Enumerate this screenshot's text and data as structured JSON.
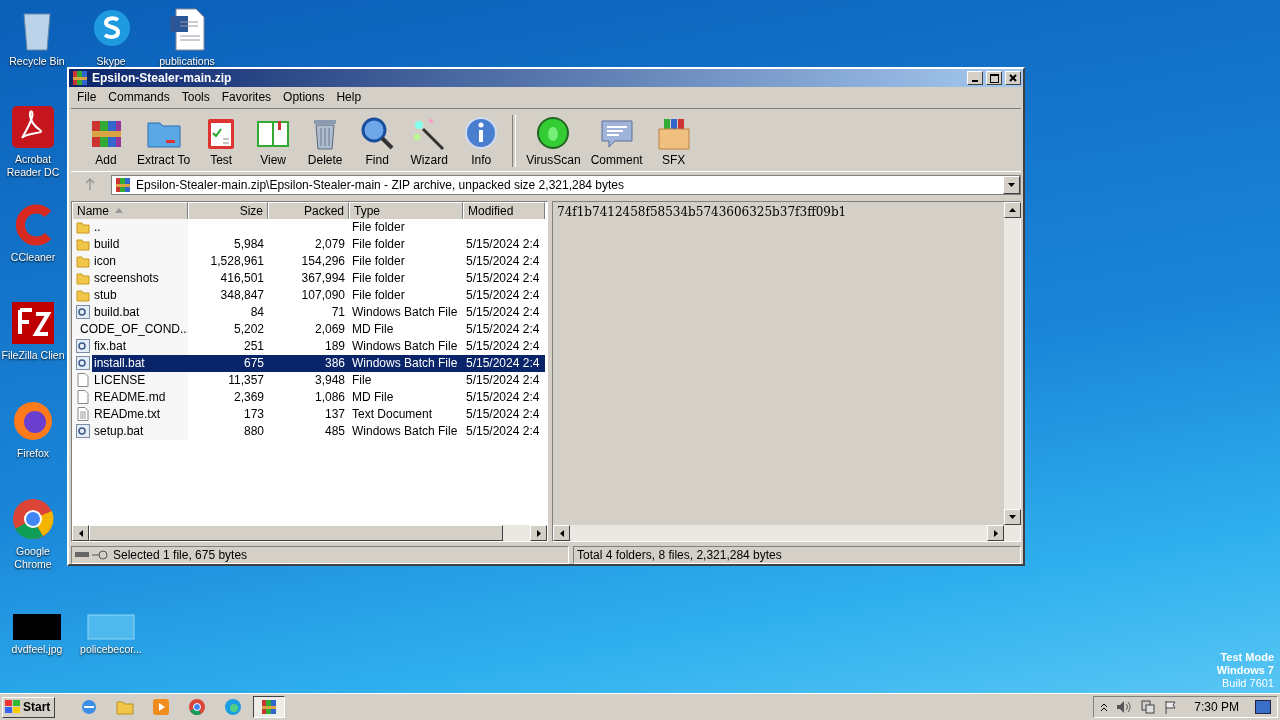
{
  "desktop": {
    "icons": [
      {
        "label": "Recycle Bin",
        "kind": "bin"
      },
      {
        "label": "Skype",
        "kind": "skype"
      },
      {
        "label": "publications",
        "kind": "word"
      },
      {
        "label": "Acrobat Reader DC",
        "kind": "acrobat"
      },
      {
        "label": "CCleaner",
        "kind": "ccleaner"
      },
      {
        "label": "FileZilla Clien",
        "kind": "filezilla"
      },
      {
        "label": "Firefox",
        "kind": "firefox"
      },
      {
        "label": "Google Chrome",
        "kind": "chrome"
      },
      {
        "label": "dvdfeel.jpg",
        "kind": "imageblack"
      },
      {
        "label": "policebecor...",
        "kind": "imageblank"
      }
    ],
    "os_info": [
      "Test Mode",
      "Windows 7",
      "Build 7601"
    ]
  },
  "window": {
    "title": "Epsilon-Stealer-main.zip",
    "menu": [
      "File",
      "Commands",
      "Tools",
      "Favorites",
      "Options",
      "Help"
    ],
    "toolbar": [
      {
        "label": "Add",
        "kind": "add"
      },
      {
        "label": "Extract To",
        "kind": "extract"
      },
      {
        "label": "Test",
        "kind": "test"
      },
      {
        "label": "View",
        "kind": "view"
      },
      {
        "label": "Delete",
        "kind": "delete"
      },
      {
        "label": "Find",
        "kind": "find"
      },
      {
        "label": "Wizard",
        "kind": "wizard"
      },
      {
        "label": "Info",
        "kind": "info"
      },
      {
        "label": "VirusScan",
        "kind": "virus"
      },
      {
        "label": "Comment",
        "kind": "comment"
      },
      {
        "label": "SFX",
        "kind": "sfx"
      }
    ],
    "address": "Epsilon-Stealer-main.zip\\Epsilon-Stealer-main - ZIP archive, unpacked size 2,321,284 bytes",
    "columns": [
      {
        "label": "Name",
        "sorted": true
      },
      {
        "label": "Size",
        "sorted": false
      },
      {
        "label": "Packed",
        "sorted": false
      },
      {
        "label": "Type",
        "sorted": false
      },
      {
        "label": "Modified",
        "sorted": false
      }
    ],
    "files": [
      {
        "name": "..",
        "type": "File folder",
        "kind": "folder",
        "selected": false
      },
      {
        "name": "build",
        "size": "5,984",
        "packed": "2,079",
        "type": "File folder",
        "modified": "5/15/2024 2:4",
        "kind": "folder",
        "selected": false
      },
      {
        "name": "icon",
        "size": "1,528,961",
        "packed": "154,296",
        "type": "File folder",
        "modified": "5/15/2024 2:4",
        "kind": "folder",
        "selected": false
      },
      {
        "name": "screenshots",
        "size": "416,501",
        "packed": "367,994",
        "type": "File folder",
        "modified": "5/15/2024 2:4",
        "kind": "folder",
        "selected": false
      },
      {
        "name": "stub",
        "size": "348,847",
        "packed": "107,090",
        "type": "File folder",
        "modified": "5/15/2024 2:4",
        "kind": "folder",
        "selected": false
      },
      {
        "name": "build.bat",
        "size": "84",
        "packed": "71",
        "type": "Windows Batch File",
        "modified": "5/15/2024 2:4",
        "kind": "batch",
        "selected": false
      },
      {
        "name": "CODE_OF_COND...",
        "size": "5,202",
        "packed": "2,069",
        "type": "MD File",
        "modified": "5/15/2024 2:4",
        "kind": "file",
        "selected": false
      },
      {
        "name": "fix.bat",
        "size": "251",
        "packed": "189",
        "type": "Windows Batch File",
        "modified": "5/15/2024 2:4",
        "kind": "batch",
        "selected": false
      },
      {
        "name": "install.bat",
        "size": "675",
        "packed": "386",
        "type": "Windows Batch File",
        "modified": "5/15/2024 2:4",
        "kind": "batch",
        "selected": true
      },
      {
        "name": "LICENSE",
        "size": "11,357",
        "packed": "3,948",
        "type": "File",
        "modified": "5/15/2024 2:4",
        "kind": "file",
        "selected": false
      },
      {
        "name": "README.md",
        "size": "2,369",
        "packed": "1,086",
        "type": "MD File",
        "modified": "5/15/2024 2:4",
        "kind": "file",
        "selected": false
      },
      {
        "name": "READme.txt",
        "size": "173",
        "packed": "137",
        "type": "Text Document",
        "modified": "5/15/2024 2:4",
        "kind": "text",
        "selected": false
      },
      {
        "name": "setup.bat",
        "size": "880",
        "packed": "485",
        "type": "Windows Batch File",
        "modified": "5/15/2024 2:4",
        "kind": "batch",
        "selected": false
      }
    ],
    "preview_text": "74f1b7412458f58534b5743606325b37f3ff09b1",
    "status_left": "Selected 1 file, 675 bytes",
    "status_right": "Total 4 folders, 8 files, 2,321,284 bytes"
  },
  "taskbar": {
    "start": "Start",
    "apps": [
      {
        "kind": "ie",
        "selected": false
      },
      {
        "kind": "explorer",
        "selected": false
      },
      {
        "kind": "media",
        "selected": false
      },
      {
        "kind": "chrome",
        "selected": false
      },
      {
        "kind": "edge",
        "selected": false
      },
      {
        "kind": "winrar",
        "selected": true
      }
    ],
    "clock": "7:30 PM"
  }
}
